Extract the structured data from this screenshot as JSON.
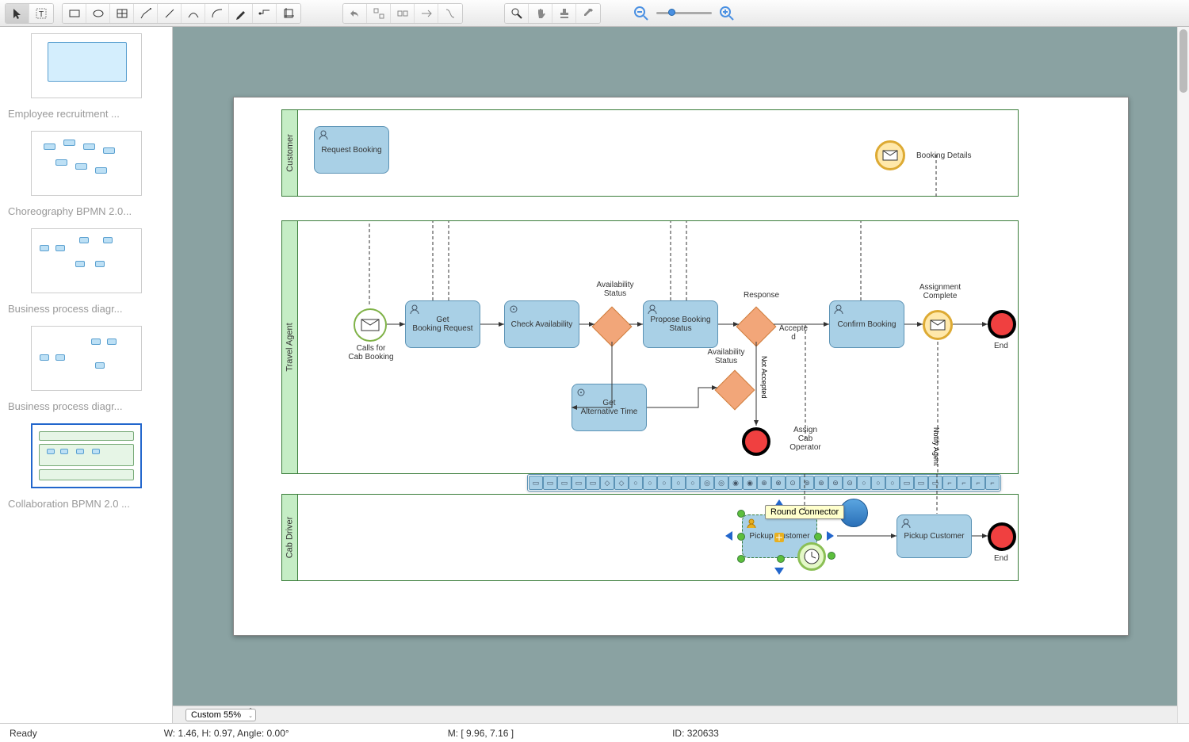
{
  "toolbar_icons": [
    "pointer",
    "text-select",
    "rect",
    "ellipse",
    "table",
    "callout",
    "line",
    "curve",
    "arc",
    "pencil",
    "connector",
    "crop"
  ],
  "toolbar_icons2": [
    "undo",
    "distribute-h",
    "distribute-v",
    "flow-h",
    "flow-free"
  ],
  "toolbar_icons3": [
    "zoom-search",
    "hand",
    "stamp",
    "eyedropper"
  ],
  "sidebar": {
    "items": [
      {
        "label": "Employee recruitment ..."
      },
      {
        "label": "Choreography BPMN 2.0..."
      },
      {
        "label": "Business process diagr..."
      },
      {
        "label": "Business process diagr..."
      },
      {
        "label": "Collaboration BPMN 2.0 ..."
      }
    ]
  },
  "lanes": {
    "customer": "Customer",
    "travel_agent": "Travel Agent",
    "cab_driver": "Cab Driver"
  },
  "tasks": {
    "request_booking": "Request Booking",
    "booking_details": "Booking Details",
    "get_booking_request": "Get\nBooking Request",
    "check_availability": "Check Availability",
    "propose_booking_status": "Propose Booking Status",
    "confirm_booking": "Confirm Booking",
    "get_alternative_time": "Get\nAlternative Time",
    "pickup_customer_1": "Pickup Customer",
    "pickup_customer_2": "Pickup Customer"
  },
  "labels": {
    "calls_for_cab": "Calls for\nCab Booking",
    "availability_status": "Availability\nStatus",
    "availability_status2": "Availability\nStatus",
    "response": "Response",
    "accepted": "Accepte\nd",
    "not_accepted": "Not Accepted",
    "assign_cab_operator": "Assign\nCab\nOperator",
    "assignment_complete": "Assignment\nComplete",
    "notify_agent": "Notify Agent",
    "end": "End",
    "end2": "End"
  },
  "tooltip": "Round Connector",
  "zoom_select": "Custom 55%",
  "status": {
    "ready": "Ready",
    "dims": "W: 1.46,  H: 0.97,  Angle: 0.00°",
    "mouse": "M: [ 9.96, 7.16 ]",
    "id": "ID: 320633"
  },
  "shape_toolbar_count": 33
}
